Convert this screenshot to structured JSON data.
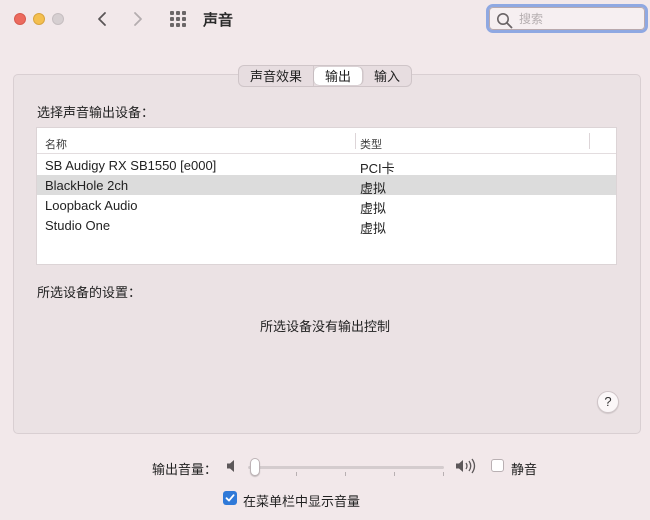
{
  "window": {
    "title": "声音"
  },
  "search": {
    "placeholder": "搜索",
    "value": ""
  },
  "tabs": [
    {
      "label": "声音效果",
      "active": false
    },
    {
      "label": "输出",
      "active": true
    },
    {
      "label": "输入",
      "active": false
    }
  ],
  "output": {
    "section_label": "选择声音输出设备：",
    "columns": [
      "名称",
      "类型"
    ],
    "devices": [
      {
        "name": "SB Audigy RX SB1550 [e000]",
        "type": "PCI卡",
        "selected": false
      },
      {
        "name": "BlackHole 2ch",
        "type": "虚拟",
        "selected": true
      },
      {
        "name": "Loopback Audio",
        "type": "虚拟",
        "selected": false
      },
      {
        "name": "Studio One",
        "type": "虚拟",
        "selected": false
      }
    ],
    "settings_label": "所选设备的设置：",
    "no_control_text": "所选设备没有输出控制"
  },
  "help": {
    "label": "?"
  },
  "volume": {
    "label": "输出音量：",
    "level": 0.02,
    "mute_label": "静音",
    "muted": false
  },
  "menubar": {
    "show_volume_label": "在菜单栏中显示音量",
    "checked": true
  },
  "colors": {
    "background": "#f2e8ea",
    "accent": "#2f79d8",
    "selected_row": "#dcdcdc",
    "search_focus": "#8fa8e2"
  },
  "icons": {
    "back": "chevron-left-icon",
    "forward": "chevron-right-icon",
    "grid": "grid-icon",
    "search": "search-icon",
    "speaker_low": "speaker-low-icon",
    "speaker_high": "speaker-high-icon",
    "checkmark": "checkmark-icon"
  }
}
